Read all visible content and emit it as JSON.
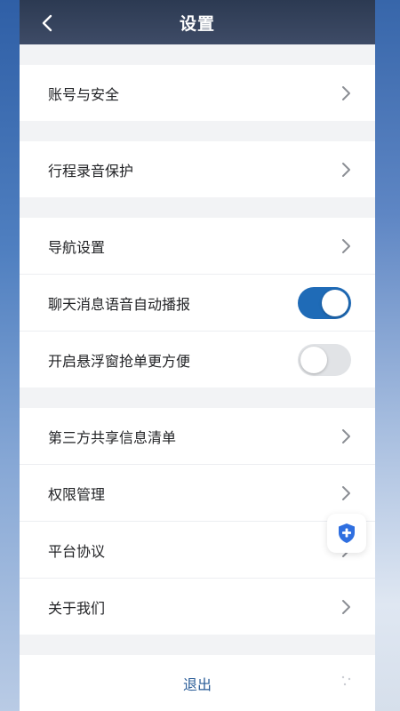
{
  "header": {
    "title": "设置"
  },
  "groups": {
    "account": {
      "label": "账号与安全"
    },
    "trip": {
      "label": "行程录音保护"
    },
    "nav": {
      "navigation_settings": {
        "label": "导航设置"
      },
      "chat_broadcast": {
        "label": "聊天消息语音自动播报",
        "enabled": true
      },
      "floating_window": {
        "label": "开启悬浮窗抢单更方便",
        "enabled": false
      }
    },
    "info": {
      "third_party": {
        "label": "第三方共享信息清单"
      },
      "permissions": {
        "label": "权限管理"
      },
      "agreement": {
        "label": "平台协议"
      },
      "about": {
        "label": "关于我们"
      }
    }
  },
  "logout": {
    "label": "退出"
  },
  "colors": {
    "accent": "#1f6bb7",
    "shield": "#2f6fe0",
    "header": "#2c3a52"
  }
}
